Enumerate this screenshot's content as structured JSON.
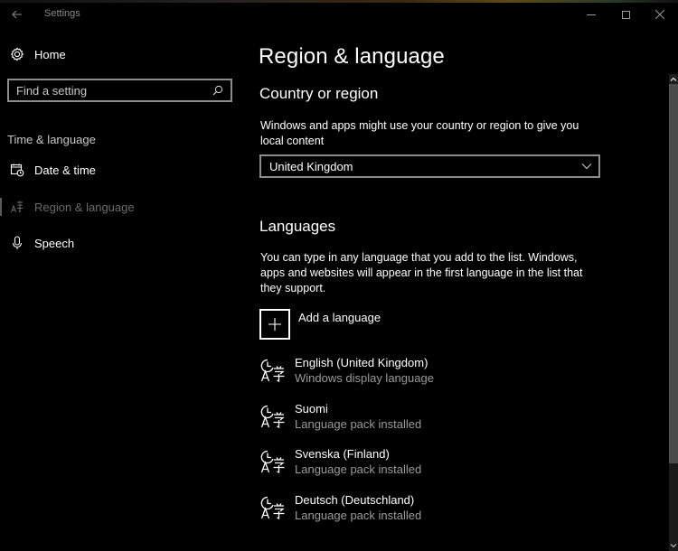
{
  "window": {
    "title": "Settings",
    "back_icon": "arrow-left-icon",
    "controls": [
      "minimize-icon",
      "maximize-icon",
      "close-icon"
    ]
  },
  "sidebar": {
    "home_label": "Home",
    "home_icon": "gear-icon",
    "search_placeholder": "Find a setting",
    "search_icon": "search-icon",
    "section_heading": "Time & language",
    "items": [
      {
        "label": "Date & time",
        "icon": "calendar-clock-icon",
        "active": false
      },
      {
        "label": "Region & language",
        "icon": "language-icon",
        "active": true
      },
      {
        "label": "Speech",
        "icon": "microphone-icon",
        "active": false
      }
    ]
  },
  "main": {
    "page_title": "Region & language",
    "country": {
      "heading": "Country or region",
      "description": "Windows and apps might use your country or region to give you local content",
      "selected_value": "United Kingdom"
    },
    "languages": {
      "heading": "Languages",
      "description": "You can type in any language that you add to the list. Windows, apps and websites will appear in the first language in the list that they support.",
      "add_label": "Add a language",
      "items": [
        {
          "name": "English (United Kingdom)",
          "status": "Windows display language"
        },
        {
          "name": "Suomi",
          "status": "Language pack installed"
        },
        {
          "name": "Svenska (Finland)",
          "status": "Language pack installed"
        },
        {
          "name": "Deutsch (Deutschland)",
          "status": "Language pack installed"
        }
      ]
    }
  },
  "colors": {
    "background": "#000000",
    "text": "#ffffff",
    "secondary_text": "#9a9a9a",
    "inactive_nav": "#6b6b6b",
    "border": "#8c8c8c",
    "scroll_thumb": "#4a4a4a"
  }
}
